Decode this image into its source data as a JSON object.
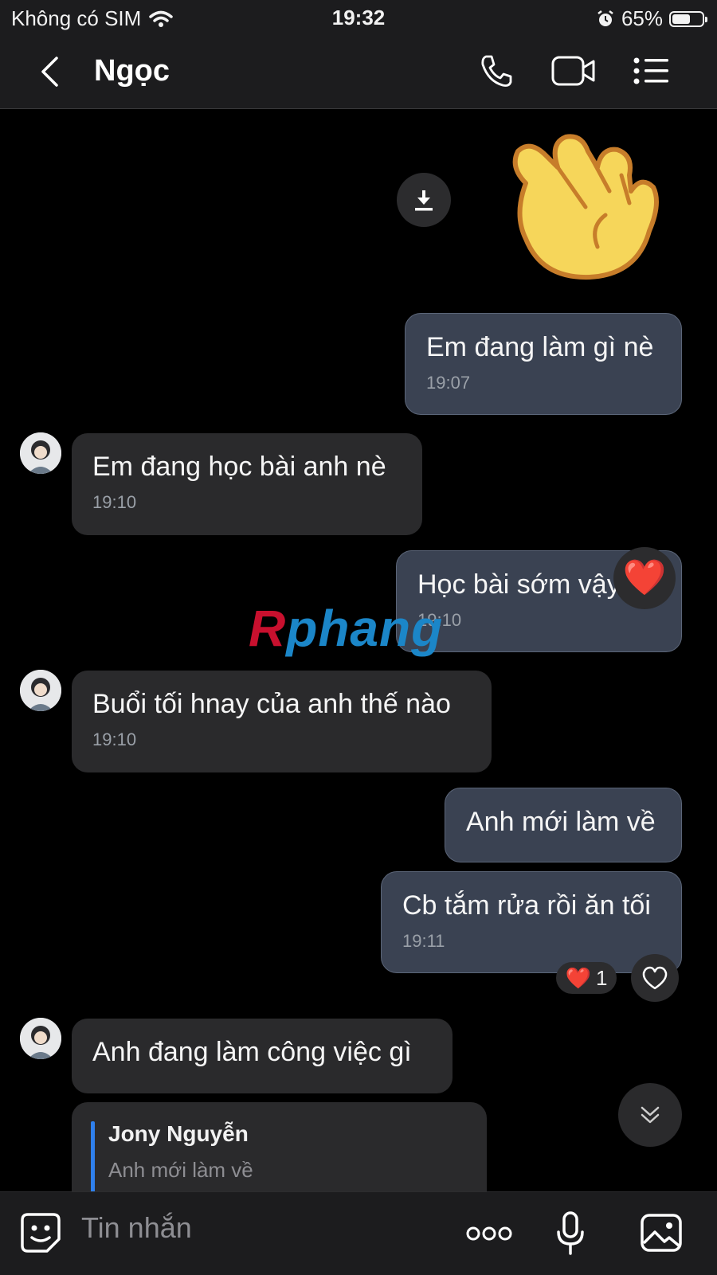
{
  "status_bar": {
    "carrier": "Không có SIM",
    "time": "19:32",
    "battery": "65%",
    "battery_level": 0.65
  },
  "header": {
    "title": "Ngọc",
    "icons": [
      "back-icon",
      "phone-icon",
      "video-icon",
      "menu-icon"
    ]
  },
  "watermark": {
    "part1": "R",
    "part2": "phang"
  },
  "messages": [
    {
      "id": "m1",
      "from": "me",
      "text": "Em đang làm gì nè",
      "time": "19:07"
    },
    {
      "id": "m2",
      "from": "them",
      "text": "Em đang học bài anh nè",
      "time": "19:10"
    },
    {
      "id": "m3",
      "from": "me",
      "text": "Học bài sớm vậy",
      "time": "19:10",
      "reaction": "❤️"
    },
    {
      "id": "m4",
      "from": "them",
      "text": "Buổi tối hnay của anh thế nào",
      "time": "19:10"
    },
    {
      "id": "m5",
      "from": "me",
      "text": "Anh mới làm về",
      "time": ""
    },
    {
      "id": "m6",
      "from": "me",
      "text": "Cb tắm rửa rồi ăn tối",
      "time": "19:11",
      "reaction_count": "1"
    },
    {
      "id": "m7",
      "from": "them",
      "text": "Anh đang làm công việc gì",
      "time": ""
    }
  ],
  "reply_preview": {
    "name": "Jony Nguyễn",
    "quoted": "Anh mới làm về"
  },
  "reaction_emoji": "❤️",
  "input": {
    "placeholder": "Tin nhắn"
  },
  "colors": {
    "background": "#000000",
    "my_bubble": "#3a4252",
    "their_bubble": "#2a2a2c",
    "accent": "#2f80ed"
  }
}
